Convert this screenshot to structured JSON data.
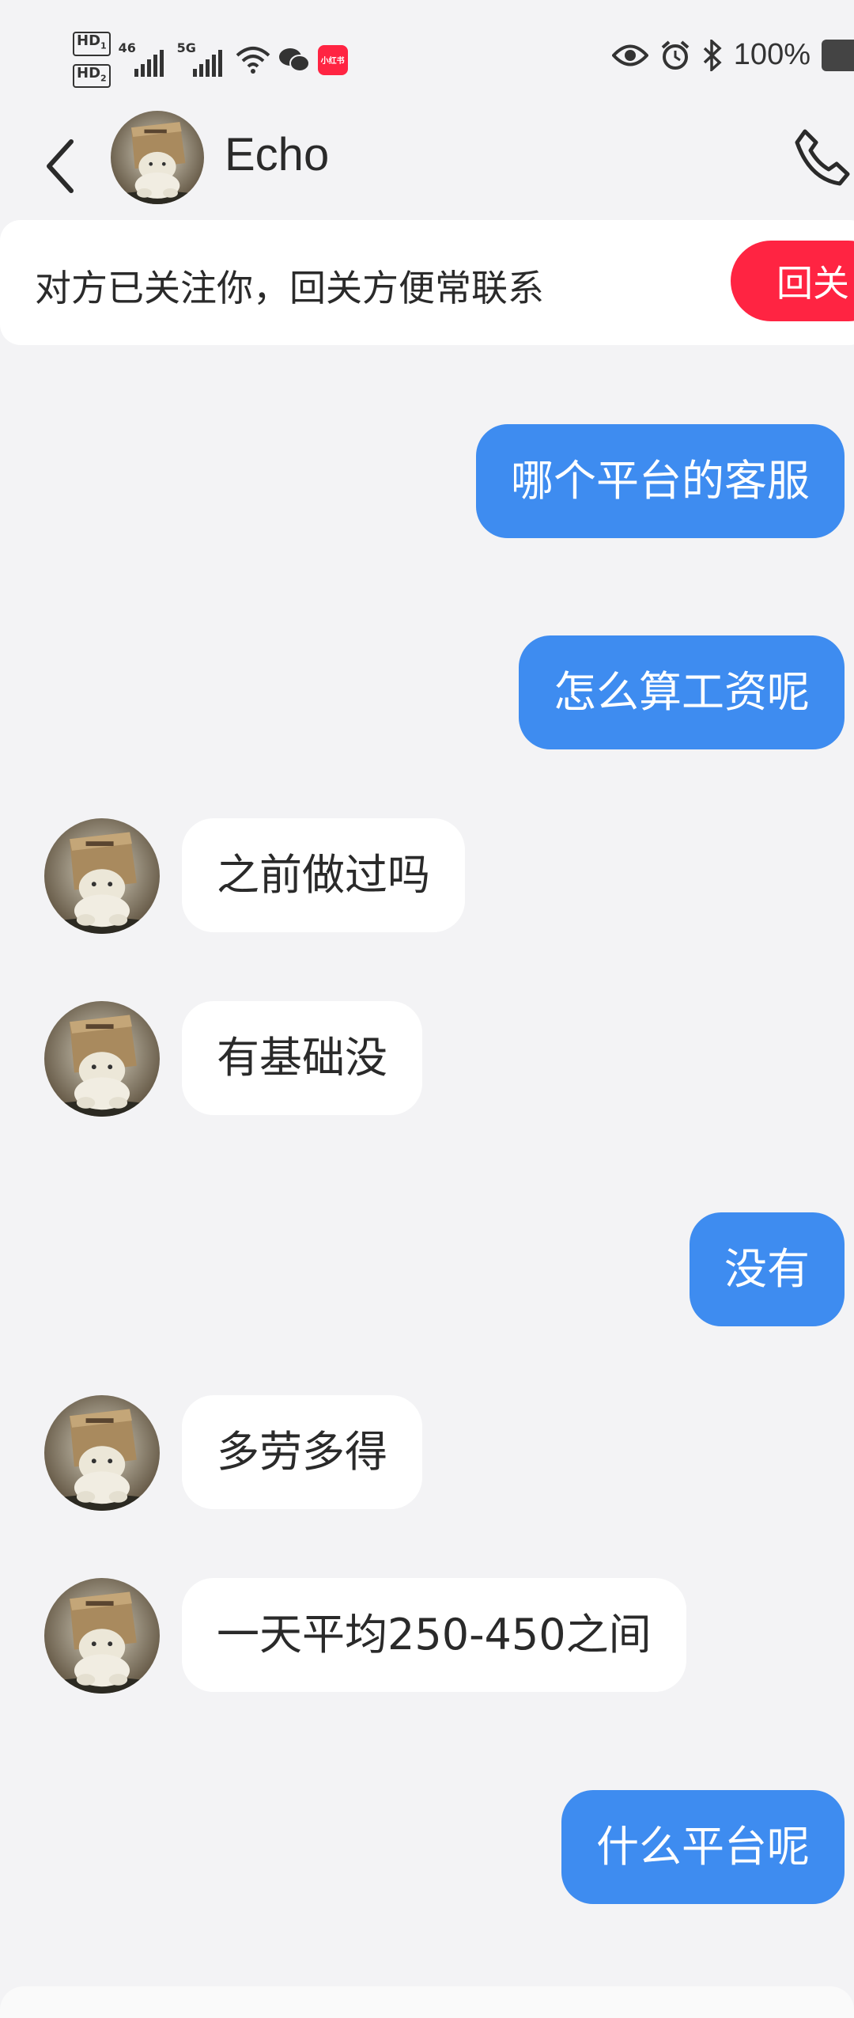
{
  "status_bar": {
    "hd1": "HD",
    "hd1_sub": "1",
    "hd2": "HD",
    "hd2_sub": "2",
    "net1": "46",
    "net2": "5G",
    "app_badge": "小红书",
    "battery_percent": "100%"
  },
  "header": {
    "contact_name": "Echo",
    "icons": [
      "back-icon",
      "avatar",
      "phone-icon"
    ]
  },
  "banner": {
    "text": "对方已关注你，回关方便常联系",
    "button_label": "回关",
    "button_color": "#ff2442"
  },
  "messages": [
    {
      "from": "me",
      "text": "哪个平台的客服"
    },
    {
      "from": "me",
      "text": "怎么算工资呢"
    },
    {
      "from": "them",
      "text": "之前做过吗"
    },
    {
      "from": "them",
      "text": "有基础没"
    },
    {
      "from": "me",
      "text": "没有"
    },
    {
      "from": "them",
      "text": "多劳多得"
    },
    {
      "from": "them",
      "text": "一天平均250-450之间"
    },
    {
      "from": "me",
      "text": "什么平台呢"
    }
  ],
  "colors": {
    "outgoing_bubble": "#3e8cf0",
    "incoming_bubble": "#ffffff",
    "background": "#f3f3f5"
  }
}
